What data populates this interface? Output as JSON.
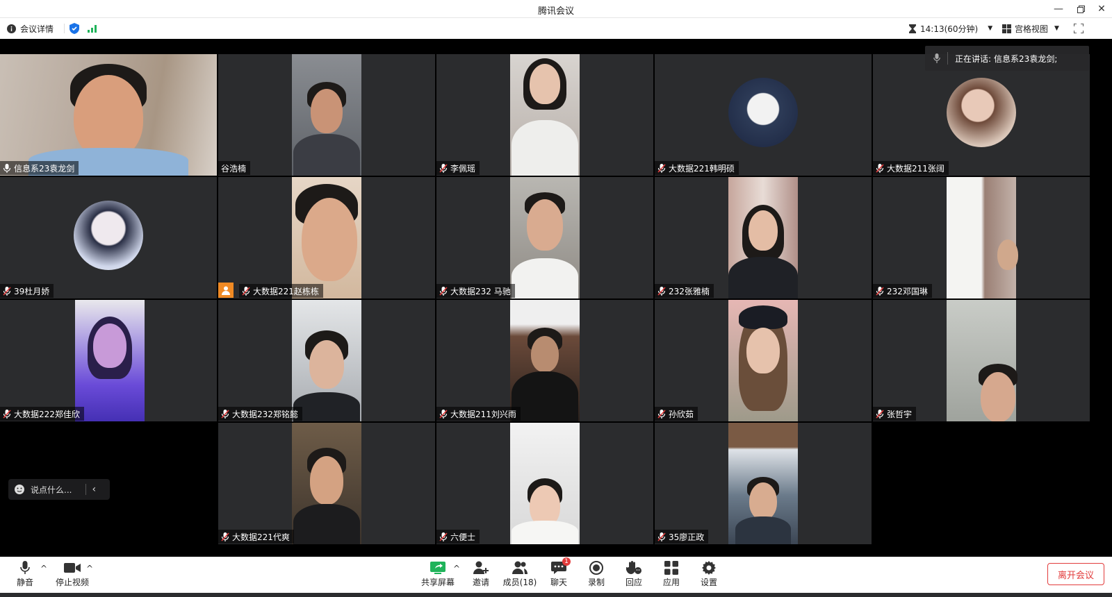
{
  "window": {
    "title": "腾讯会议"
  },
  "topbar": {
    "meeting_info": "会议详情",
    "timer": "14:13(60分钟)",
    "view_mode": "宫格视图"
  },
  "speaking": {
    "label": "正在讲话:",
    "name": "信息系23袁龙剑;"
  },
  "chat": {
    "placeholder": "说点什么..."
  },
  "participants": [
    {
      "name": "信息系23袁龙剑",
      "muted": false,
      "active_speaker": true
    },
    {
      "name": "谷浩楠",
      "muted": false
    },
    {
      "name": "李佩瑶",
      "muted": true
    },
    {
      "name": "大数据221韩明硕",
      "muted": true
    },
    {
      "name": "大数据211张阔",
      "muted": true
    },
    {
      "name": "39杜月娇",
      "muted": true
    },
    {
      "name": "大数据221赵栋栋",
      "muted": true,
      "host": true
    },
    {
      "name": "大数据232 马驰",
      "muted": true
    },
    {
      "name": "232张雅楠",
      "muted": true
    },
    {
      "name": "232邓国琳",
      "muted": true
    },
    {
      "name": "大数据222郑佳欣",
      "muted": true
    },
    {
      "name": "大数据232郑铭懿",
      "muted": true
    },
    {
      "name": "大数据211刘兴雨",
      "muted": true
    },
    {
      "name": "孙欣茹",
      "muted": true
    },
    {
      "name": "张哲宇",
      "muted": true
    },
    {
      "name": "大数据221代爽",
      "muted": true
    },
    {
      "name": "六便士",
      "muted": true
    },
    {
      "name": "35廖正政",
      "muted": true
    }
  ],
  "bottombar": {
    "mute": "静音",
    "stop_video": "停止视频",
    "share": "共享屏幕",
    "invite": "邀请",
    "members": "成员(18)",
    "chat": "聊天",
    "chat_badge": "1",
    "record": "录制",
    "react": "回应",
    "apps": "应用",
    "settings": "设置",
    "leave": "离开会议"
  },
  "colors": {
    "active_border": "#1fcf6c",
    "leave": "#e23b3b",
    "tile_bg": "#2b2c2e"
  }
}
